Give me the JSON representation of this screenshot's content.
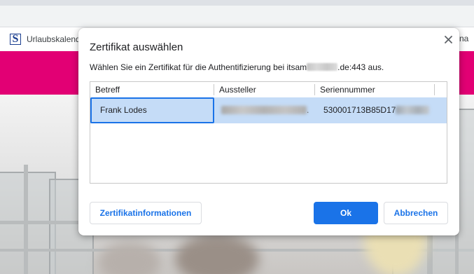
{
  "browser": {
    "bookmark_label": "Urlaubskalend",
    "bookmark_icon_letter": "S",
    "bookmark_right_fragment": "na"
  },
  "dialog": {
    "title": "Zertifikat auswählen",
    "description_prefix": "Wählen Sie ein Zertifikat für die Authentifizierung bei itsam",
    "description_suffix": ".de:443 aus.",
    "close_icon": "close-icon",
    "table": {
      "columns": [
        "Betreff",
        "Aussteller",
        "Seriennummer"
      ],
      "rows": [
        {
          "betreff": "Frank Lodes",
          "aussteller_suffix": ".",
          "serial_prefix": "530001713B85D17"
        }
      ]
    },
    "buttons": {
      "info": "Zertifikatinformationen",
      "ok": "Ok",
      "cancel": "Abbrechen"
    }
  },
  "colors": {
    "accent": "#1a73e8",
    "selection": "#c5dcf7",
    "brand_banner": "#e20074"
  }
}
